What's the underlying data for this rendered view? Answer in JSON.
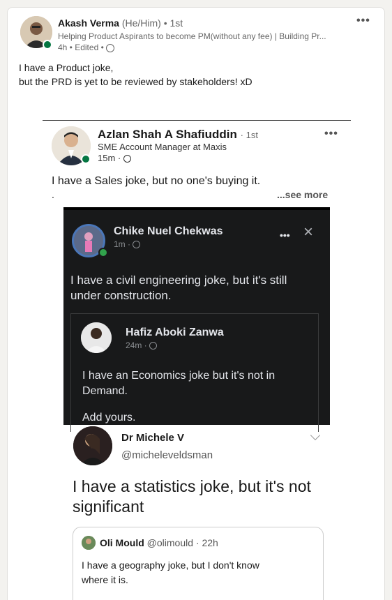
{
  "post": {
    "author": "Akash Verma",
    "pronouns": "(He/Him)",
    "degree": "• 1st",
    "headline": "Helping Product Aspirants to become PM(without any fee) | Building Pr...",
    "meta": "4h • Edited •",
    "body_line1": "I have a Product joke,",
    "body_line2": "but the PRD is yet to be reviewed by stakeholders! xD",
    "more_icon": "more-dots-icon"
  },
  "shared_post": {
    "author": "Azlan Shah A Shafiuddin",
    "degree": "· 1st",
    "headline": "SME Account Manager at Maxis",
    "meta": "15m ·",
    "body": "I have a Sales joke, but no one's buying it.",
    "dot": ".",
    "see_more": "...see more"
  },
  "fb_post": {
    "author": "Chike Nuel Chekwas",
    "meta": "1m ·",
    "body_line1": "I have a civil engineering joke, but it's still",
    "body_line2": "under construction.",
    "close_icon": "×",
    "nested": {
      "author": "Hafiz Aboki Zanwa",
      "meta": "24m ·",
      "body_line1": "I have an Economics joke but it's not in",
      "body_line2": "Demand.",
      "footer": "Add yours."
    }
  },
  "tweet": {
    "author": "Dr Michele V",
    "handle": "@micheleveldsman",
    "body_line1": "I have a statistics joke, but it's not",
    "body_line2": "significant",
    "quote": {
      "author": "Oli Mould",
      "handle_time": "@olimould · 22h",
      "body_line1": "I have a geography joke, but I don't know",
      "body_line2": "where it is."
    }
  }
}
